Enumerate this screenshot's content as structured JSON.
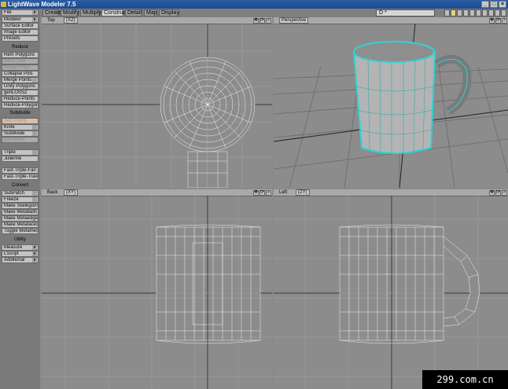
{
  "window": {
    "title": "LightWave Modeler 7.5"
  },
  "tabs": [
    "Create",
    "Modify",
    "Multiply",
    "Construct",
    "Detail",
    "Map",
    "Display"
  ],
  "active_tab": "Construct",
  "layer_selector": "D *",
  "sidebar": {
    "top": [
      {
        "label": "File"
      },
      {
        "label": "Modeler"
      },
      {
        "label": "Surface Editor"
      },
      {
        "label": "Image Editor"
      },
      {
        "label": "Presets"
      }
    ],
    "reduce_title": "Reduce",
    "reduce": [
      {
        "label": "Rem Polygons"
      },
      {
        "label": "Band Saw"
      },
      {
        "label": "Merge Polys"
      },
      {
        "label": "Collapse Pols"
      },
      {
        "label": "Merge Points"
      },
      {
        "label": "Unify Polygons"
      },
      {
        "label": "genLOSS2"
      },
      {
        "label": "Reduce-Points"
      },
      {
        "label": "Reduce-Polygons"
      }
    ],
    "subdivide_title": "Subdivide",
    "subdivide": [
      {
        "label": "Add Points"
      },
      {
        "label": "Knife"
      },
      {
        "label": "Subdivide"
      },
      {
        "label": "BandGlue"
      },
      {
        "label": "Triple"
      },
      {
        "label": "Julienne"
      },
      {
        "label": "Fast-Triple-Fan"
      },
      {
        "label": "Fast-Triple-Trave..."
      }
    ],
    "convert_title": "Convert",
    "convert": [
      {
        "label": "SubPatch"
      },
      {
        "label": "Freeze"
      },
      {
        "label": "Make Skelegons"
      },
      {
        "label": "Make Metaballs"
      },
      {
        "label": "Make Metaedges"
      },
      {
        "label": "Make Metafaces"
      },
      {
        "label": "Toggle Metamesh"
      }
    ],
    "utility_title": "Utility",
    "utility": [
      {
        "label": "Measure"
      },
      {
        "label": "LScript"
      },
      {
        "label": "Additional"
      }
    ]
  },
  "viewports": {
    "top": {
      "label": "Top",
      "mode": "(XZ)"
    },
    "perspective": {
      "label": "Perspective",
      "mode": ""
    },
    "back": {
      "label": "Back",
      "mode": "(XY)"
    },
    "left": {
      "label": "Left",
      "mode": "(ZY)"
    }
  },
  "watermark": "299.com.cn"
}
